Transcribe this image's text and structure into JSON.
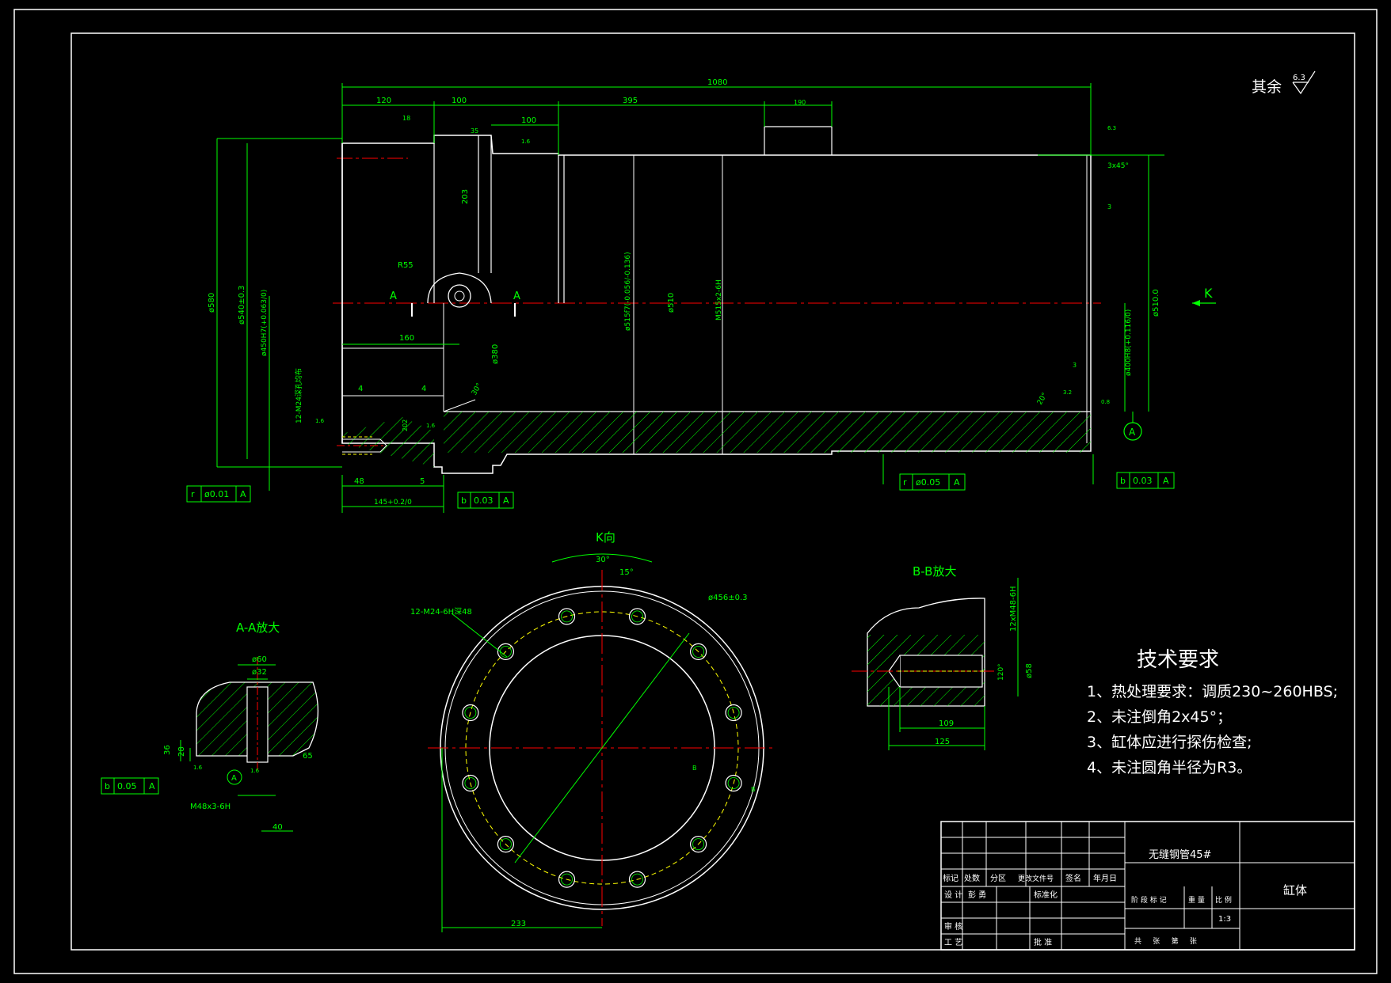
{
  "colors": {
    "background": "#000000",
    "outline": "#ffffff",
    "dimension": "#00ff00",
    "centerline": "#ff0000",
    "hidden": "#ffff00"
  },
  "roughness_note": {
    "label": "其余",
    "value": "6.3"
  },
  "main_view": {
    "dims": {
      "overall": "1080",
      "d120": "120",
      "d100": "100",
      "d395": "395",
      "d100b": "100",
      "d190": "190",
      "d18": "18",
      "d35": "35",
      "d203": "203",
      "r55": "R55",
      "d160": "160",
      "d380": "ø380",
      "dia515": "ø515f7(-0.056/-0.136)",
      "dia510": "ø510",
      "thread515": "M515x2-6H",
      "dia510_0": "ø510.0",
      "dia400": "ø400H8(+0.116/0)",
      "chamfer": "3x45°",
      "d3a": "3",
      "d3b": "3",
      "d4a": "4",
      "d4b": "4",
      "d30": "30°",
      "d20": "20°",
      "d48": "48",
      "d5": "5",
      "d145": "145+0.2/0",
      "d202": "202",
      "dia580": "ø580",
      "dia540": "ø540±0.3",
      "dia450": "ø450H7(+0.063/0)",
      "holes": "12-M24深孔均布",
      "rough_a": "1.6",
      "rough_b": "1.6",
      "rough_c": "1.6",
      "rough_d": "0.8",
      "rough_e": "3.2",
      "rough_f": "6.3",
      "sec_a1": "A",
      "sec_a2": "A",
      "view_k": "K",
      "datum": "A"
    },
    "tolerance_frames": [
      {
        "sym": "r",
        "val": "ø0.01",
        "ref": "A"
      },
      {
        "sym": "b",
        "val": "0.03",
        "ref": "A"
      },
      {
        "sym": "r",
        "val": "ø0.05",
        "ref": "A"
      },
      {
        "sym": "b",
        "val": "0.03",
        "ref": "A"
      }
    ]
  },
  "section_aa": {
    "title": "A-A放大",
    "dims": {
      "d60": "ø60",
      "d32": "ø32",
      "d36": "36",
      "d28": "28",
      "d65": "65",
      "thread": "M48x3-6H",
      "d40": "40",
      "r1": "1.6",
      "r2": "1.6",
      "datum": "A"
    },
    "tolerance": {
      "sym": "b",
      "val": "0.05",
      "ref": "A"
    }
  },
  "view_k": {
    "title": "K向",
    "dims": {
      "a30": "30°",
      "a15": "15°",
      "holes": "12-M24-6H深48",
      "pcd": "ø456±0.3",
      "d233": "233",
      "b1": "B",
      "b2": "B"
    }
  },
  "section_bb": {
    "title": "B-B放大",
    "dims": {
      "thread": "12xM48-6H",
      "dia": "ø58",
      "angle": "120°",
      "d109": "109",
      "d125": "125"
    }
  },
  "tech_requirements": {
    "title": "技术要求",
    "items": [
      "1、热处理要求：调质230~260HBS;",
      "2、未注倒角2x45°；",
      "3、缸体应进行探伤检查;",
      "4、未注圆角半径为R3。"
    ]
  },
  "title_block": {
    "material": "无缝钢管45#",
    "part_name": "缸体",
    "rev_headers": [
      "标记",
      "处数",
      "分区",
      "更改文件号",
      "签名",
      "年月日"
    ],
    "design": "设 计",
    "design_name": "彭 勇",
    "standard": "标准化",
    "stage_labels": [
      "阶 段 标 记",
      "重 量",
      "比 例"
    ],
    "scale": "1:3",
    "review": "审 核",
    "process": "工 艺",
    "approve": "批 准",
    "sheets": "共     张     第     张"
  }
}
